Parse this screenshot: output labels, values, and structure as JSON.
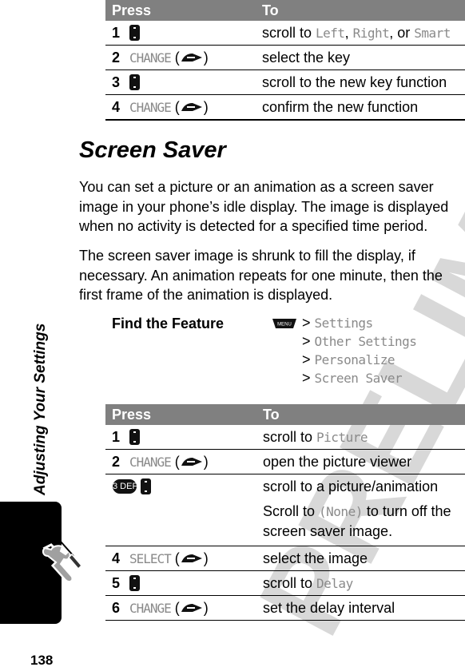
{
  "watermark": "PRELIMINARY",
  "sidebar": {
    "section_title": "Adjusting Your Settings",
    "icon": "tools-icon"
  },
  "page_number": "138",
  "table_top": {
    "headers": {
      "press": "Press",
      "to": "To"
    },
    "rows": [
      {
        "num": "1",
        "press_icon": "nav-key-icon",
        "to_prefix": "scroll to ",
        "to_parts": [
          {
            "t": "Left",
            "mono": true
          },
          {
            "t": ", ",
            "mono": false
          },
          {
            "t": "Right",
            "mono": true
          },
          {
            "t": ", or ",
            "mono": false
          },
          {
            "t": "Smart",
            "mono": true
          }
        ]
      },
      {
        "num": "2",
        "softkey": "CHANGE",
        "press_icon": "soft-key-icon",
        "to_text": "select the key"
      },
      {
        "num": "3",
        "press_icon": "nav-key-icon",
        "to_text": "scroll to the new key function"
      },
      {
        "num": "4",
        "softkey": "CHANGE",
        "press_icon": "soft-key-icon",
        "to_text": "confirm the new function"
      }
    ]
  },
  "section": {
    "title": "Screen Saver",
    "paragraphs": [
      "You can set a picture or an animation as a screen saver image in your phone’s idle display. The image is displayed when no activity is detected for a specified time period.",
      "The screen saver image is shrunk to fill the display, if necessary. An animation repeats for one minute, then the first frame of the animation is displayed."
    ]
  },
  "find_feature": {
    "label": "Find the Feature",
    "menu_key": "MENU",
    "separator": ">",
    "path": [
      "Settings",
      "Other Settings",
      "Personalize",
      "Screen Saver"
    ]
  },
  "table_bottom": {
    "headers": {
      "press": "Press",
      "to": "To"
    },
    "rows": [
      {
        "num": "1",
        "press_icon": "nav-key-icon",
        "to_prefix": "scroll to ",
        "to_mono": "Picture"
      },
      {
        "num": "2",
        "softkey": "CHANGE",
        "press_icon": "soft-key-icon",
        "to_text": "open the picture viewer"
      },
      {
        "num": "",
        "key_label": "3 DEF",
        "press_icon": "nav-key-icon",
        "to_text": "scroll to a picture/animation",
        "note_prefix": "Scroll to ",
        "note_mono": "(None)",
        "note_suffix": " to turn off the screen saver image."
      },
      {
        "num": "4",
        "softkey": "SELECT",
        "press_icon": "soft-key-icon",
        "to_text": "select the image"
      },
      {
        "num": "5",
        "press_icon": "nav-key-icon",
        "to_prefix": "scroll to ",
        "to_mono": "Delay"
      },
      {
        "num": "6",
        "softkey": "CHANGE",
        "press_icon": "soft-key-icon",
        "to_text": "set the delay interval"
      }
    ]
  },
  "colors": {
    "header_bg": "#808080",
    "display_text": "#8a8a8a",
    "watermark": "#d8d8d8"
  }
}
